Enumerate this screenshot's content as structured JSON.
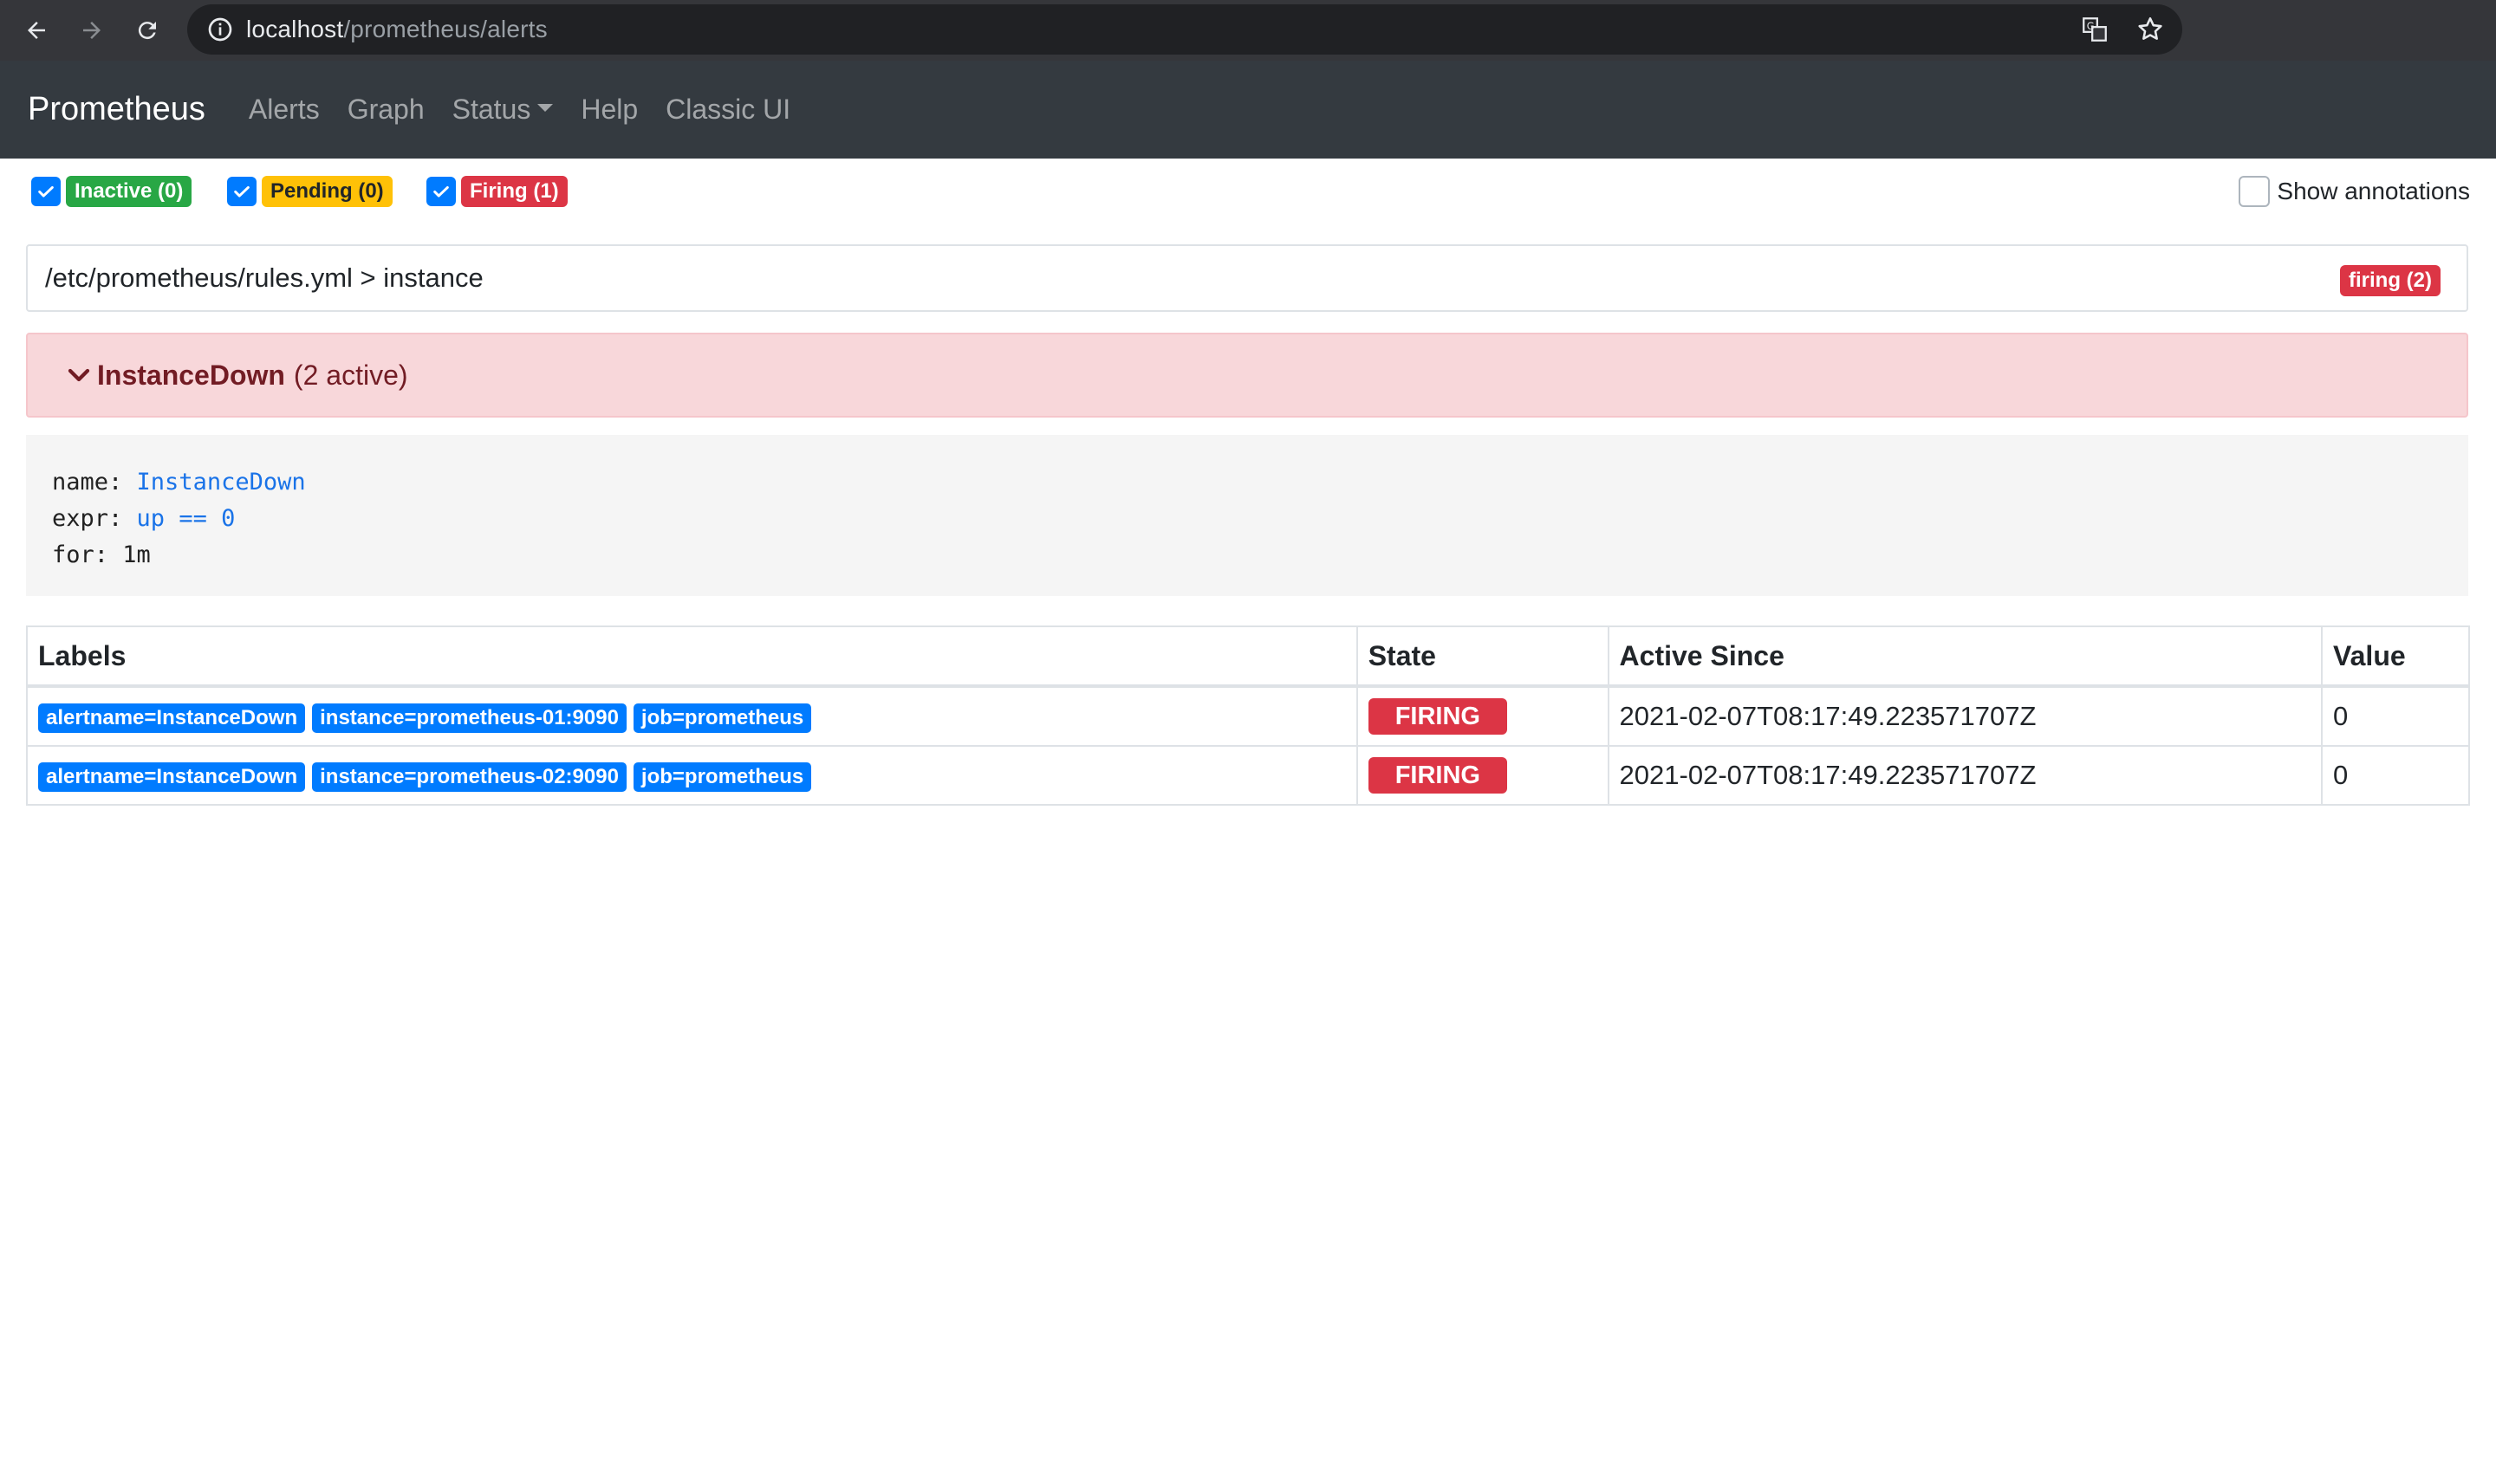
{
  "browser": {
    "url_host": "localhost",
    "url_path": "/prometheus/alerts"
  },
  "nav": {
    "brand": "Prometheus",
    "links": [
      "Alerts",
      "Graph",
      "Status",
      "Help",
      "Classic UI"
    ]
  },
  "filters": {
    "inactive": "Inactive (0)",
    "pending": "Pending (0)",
    "firing": "Firing (1)",
    "show_annotations": "Show annotations"
  },
  "group": {
    "path": "/etc/prometheus/rules.yml > instance",
    "status_badge": "firing (2)"
  },
  "alert": {
    "name": "InstanceDown",
    "active": "(2 active)",
    "rule": {
      "name_key": "name:",
      "name_val": "InstanceDown",
      "expr_key": "expr:",
      "expr_val": "up == 0",
      "for_line": "for: 1m"
    }
  },
  "table": {
    "headers": [
      "Labels",
      "State",
      "Active Since",
      "Value"
    ],
    "rows": [
      {
        "labels": [
          "alertname=InstanceDown",
          "instance=prometheus-01:9090",
          "job=prometheus"
        ],
        "state": "FIRING",
        "active_since": "2021-02-07T08:17:49.223571707Z",
        "value": "0"
      },
      {
        "labels": [
          "alertname=InstanceDown",
          "instance=prometheus-02:9090",
          "job=prometheus"
        ],
        "state": "FIRING",
        "active_since": "2021-02-07T08:17:49.223571707Z",
        "value": "0"
      }
    ]
  },
  "colors": {
    "navbar": "#343a40",
    "firing": "#dc3545",
    "label_blue": "#007bff",
    "alert_bg": "#f8d7da"
  }
}
